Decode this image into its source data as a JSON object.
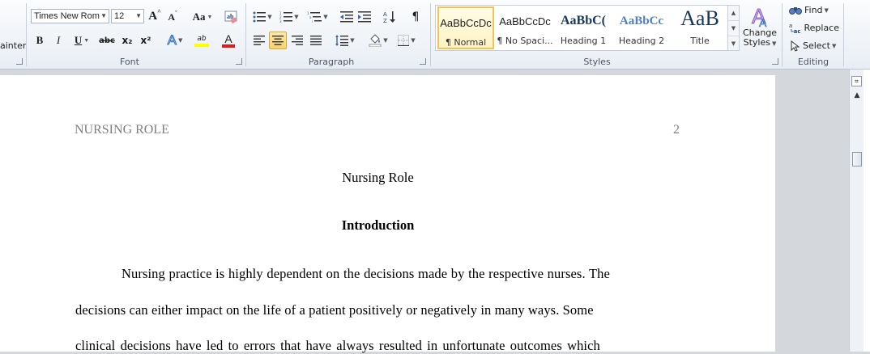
{
  "font": {
    "font_name": "Times New Rom",
    "font_size": "12",
    "grow_label": "A",
    "shrink_label": "A",
    "case_label": "Aa",
    "bold": "B",
    "italic": "I",
    "underline": "U",
    "strike": "abc",
    "subscript": "x₂",
    "superscript": "x²",
    "highlight_label": "ab",
    "font_color_label": "A",
    "group_label": "Font"
  },
  "clipboard": {
    "painter_label": "ainter"
  },
  "paragraph": {
    "group_label": "Paragraph",
    "pilcrow": "¶"
  },
  "styles": {
    "group_label": "Styles",
    "items": [
      {
        "preview": "AaBbCcDc",
        "name": "¶ Normal"
      },
      {
        "preview": "AaBbCcDc",
        "name": "¶ No Spaci..."
      },
      {
        "preview": "AaBbC(",
        "name": "Heading 1"
      },
      {
        "preview": "AaBbCc",
        "name": "Heading 2"
      },
      {
        "preview": "AaB",
        "name": "Title"
      }
    ],
    "change_styles_line1": "Change",
    "change_styles_line2": "Styles",
    "heading_color": "#17365d",
    "heading2_color": "#4f81bd"
  },
  "editing": {
    "group_label": "Editing",
    "find": "Find",
    "replace": "Replace",
    "select": "Select"
  },
  "document": {
    "running_head": "NURSING ROLE",
    "page_number": "2",
    "title": "Nursing Role",
    "heading": "Introduction",
    "lines": [
      "Nursing practice is highly dependent on the decisions made by the respective nurses. The",
      "decisions can either impact on the life of a patient positively or negatively in many ways. Some",
      "clinical decisions have led to errors that have always resulted in unfortunate outcomes which"
    ]
  }
}
